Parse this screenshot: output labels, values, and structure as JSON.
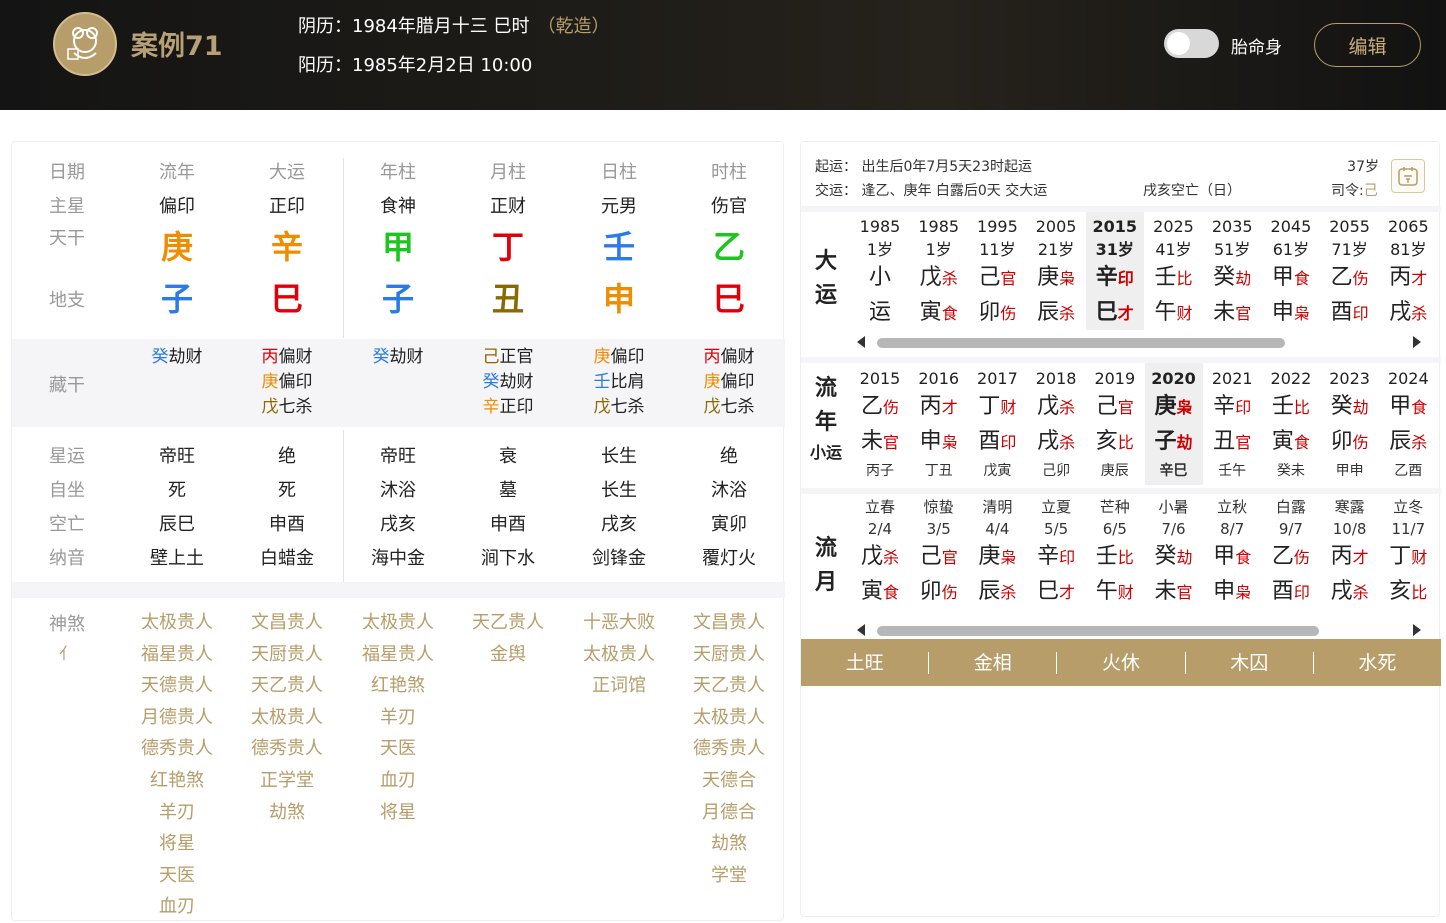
{
  "header": {
    "title": "案例71",
    "lunar_label": "阴历：1984年腊月十三 巳时",
    "lunar_gender": "（乾造）",
    "solar_label": "阳历：1985年2月2日 10:00",
    "toggle_label": "胎命身",
    "toggle_on": false,
    "edit_label": "编辑"
  },
  "colors": {
    "gold": "#b69d6a",
    "wood": "#1fc51f",
    "fire": "#e0000a",
    "earth": "#8a6a00",
    "metal": "#f08c00",
    "water": "#2a7be6"
  },
  "pillars": {
    "row_labels": [
      "日期",
      "主星",
      "天干",
      "地支",
      "藏干",
      "星运",
      "自坐",
      "空亡",
      "纳音",
      "神煞"
    ],
    "shensha_icon": "collapse-icon",
    "columns": [
      {
        "header": "流年",
        "star": "偏印",
        "stem": "庚",
        "stem_color": "#f08c00",
        "branch": "子",
        "branch_color": "#2a7be6",
        "hidden": [
          {
            "g": "癸",
            "gc": "#2a7be6",
            "t": "劫财"
          }
        ],
        "xingyun": "帝旺",
        "zizuo": "死",
        "kongwang": "辰巳",
        "nayin": "壁上土",
        "shensha": [
          "太极贵人",
          "福星贵人",
          "天德贵人",
          "月德贵人",
          "德秀贵人",
          "红艳煞",
          "羊刃",
          "将星",
          "天医",
          "血刃"
        ]
      },
      {
        "header": "大运",
        "star": "正印",
        "stem": "辛",
        "stem_color": "#f08c00",
        "branch": "巳",
        "branch_color": "#e0000a",
        "hidden": [
          {
            "g": "丙",
            "gc": "#e0000a",
            "t": "偏财"
          },
          {
            "g": "庚",
            "gc": "#f08c00",
            "t": "偏印"
          },
          {
            "g": "戊",
            "gc": "#8a6a00",
            "t": "七杀"
          }
        ],
        "xingyun": "绝",
        "zizuo": "死",
        "kongwang": "申酉",
        "nayin": "白蜡金",
        "shensha": [
          "文昌贵人",
          "天厨贵人",
          "天乙贵人",
          "太极贵人",
          "德秀贵人",
          "正学堂",
          "劫煞"
        ]
      },
      {
        "header": "年柱",
        "star": "食神",
        "stem": "甲",
        "stem_color": "#1fc51f",
        "branch": "子",
        "branch_color": "#2a7be6",
        "hidden": [
          {
            "g": "癸",
            "gc": "#2a7be6",
            "t": "劫财"
          }
        ],
        "xingyun": "帝旺",
        "zizuo": "沐浴",
        "kongwang": "戌亥",
        "nayin": "海中金",
        "shensha": [
          "太极贵人",
          "福星贵人",
          "红艳煞",
          "羊刃",
          "天医",
          "血刃",
          "将星"
        ]
      },
      {
        "header": "月柱",
        "star": "正财",
        "stem": "丁",
        "stem_color": "#e0000a",
        "branch": "丑",
        "branch_color": "#8a6a00",
        "hidden": [
          {
            "g": "己",
            "gc": "#8a6a00",
            "t": "正官"
          },
          {
            "g": "癸",
            "gc": "#2a7be6",
            "t": "劫财"
          },
          {
            "g": "辛",
            "gc": "#f08c00",
            "t": "正印"
          }
        ],
        "xingyun": "衰",
        "zizuo": "墓",
        "kongwang": "申酉",
        "nayin": "涧下水",
        "shensha": [
          "天乙贵人",
          "金舆"
        ]
      },
      {
        "header": "日柱",
        "star": "元男",
        "stem": "壬",
        "stem_color": "#2a7be6",
        "branch": "申",
        "branch_color": "#f08c00",
        "hidden": [
          {
            "g": "庚",
            "gc": "#f08c00",
            "t": "偏印"
          },
          {
            "g": "壬",
            "gc": "#2a7be6",
            "t": "比肩"
          },
          {
            "g": "戊",
            "gc": "#8a6a00",
            "t": "七杀"
          }
        ],
        "xingyun": "长生",
        "zizuo": "长生",
        "kongwang": "戌亥",
        "nayin": "剑锋金",
        "shensha": [
          "十恶大败",
          "太极贵人",
          "正词馆"
        ]
      },
      {
        "header": "时柱",
        "star": "伤官",
        "stem": "乙",
        "stem_color": "#1fc51f",
        "branch": "巳",
        "branch_color": "#e0000a",
        "hidden": [
          {
            "g": "丙",
            "gc": "#e0000a",
            "t": "偏财"
          },
          {
            "g": "庚",
            "gc": "#f08c00",
            "t": "偏印"
          },
          {
            "g": "戊",
            "gc": "#8a6a00",
            "t": "七杀"
          }
        ],
        "xingyun": "绝",
        "zizuo": "沐浴",
        "kongwang": "寅卯",
        "nayin": "覆灯火",
        "shensha": [
          "文昌贵人",
          "天厨贵人",
          "天乙贵人",
          "太极贵人",
          "德秀贵人",
          "天德合",
          "月德合",
          "劫煞",
          "学堂"
        ]
      }
    ]
  },
  "luck": {
    "qiyun": "起运： 出生后0年7月5天23时起运",
    "jiaoyun": "交运： 逢乙、庚年 白露后0天 交大运",
    "kongwang": "戌亥空亡（日）",
    "age": "37岁",
    "siling": "司令:",
    "siling_value": "己",
    "calendar_icon": "calendar-icon",
    "dayun_label": [
      "大",
      "运"
    ],
    "dayun": [
      {
        "y": "1985",
        "a": "1岁",
        "g1": "小",
        "s1": "",
        "g2": "运",
        "s2": ""
      },
      {
        "y": "1985",
        "a": "1岁",
        "g1": "戊",
        "s1": "杀",
        "g2": "寅",
        "s2": "食"
      },
      {
        "y": "1995",
        "a": "11岁",
        "g1": "己",
        "s1": "官",
        "g2": "卯",
        "s2": "伤"
      },
      {
        "y": "2005",
        "a": "21岁",
        "g1": "庚",
        "s1": "枭",
        "g2": "辰",
        "s2": "杀"
      },
      {
        "y": "2015",
        "a": "31岁",
        "g1": "辛",
        "s1": "印",
        "g2": "巳",
        "s2": "才",
        "hl": true
      },
      {
        "y": "2025",
        "a": "41岁",
        "g1": "壬",
        "s1": "比",
        "g2": "午",
        "s2": "财"
      },
      {
        "y": "2035",
        "a": "51岁",
        "g1": "癸",
        "s1": "劫",
        "g2": "未",
        "s2": "官"
      },
      {
        "y": "2045",
        "a": "61岁",
        "g1": "甲",
        "s1": "食",
        "g2": "申",
        "s2": "枭"
      },
      {
        "y": "2055",
        "a": "71岁",
        "g1": "乙",
        "s1": "伤",
        "g2": "酉",
        "s2": "印"
      },
      {
        "y": "2065",
        "a": "81岁",
        "g1": "丙",
        "s1": "才",
        "g2": "戌",
        "s2": "杀"
      }
    ],
    "liunian_label": [
      "流",
      "年"
    ],
    "xiaoyun_label": "小运",
    "liunian": [
      {
        "y": "2015",
        "g1": "乙",
        "s1": "伤",
        "g2": "未",
        "s2": "官",
        "x": "丙子"
      },
      {
        "y": "2016",
        "g1": "丙",
        "s1": "才",
        "g2": "申",
        "s2": "枭",
        "x": "丁丑"
      },
      {
        "y": "2017",
        "g1": "丁",
        "s1": "财",
        "g2": "酉",
        "s2": "印",
        "x": "戊寅"
      },
      {
        "y": "2018",
        "g1": "戊",
        "s1": "杀",
        "g2": "戌",
        "s2": "杀",
        "x": "己卯"
      },
      {
        "y": "2019",
        "g1": "己",
        "s1": "官",
        "g2": "亥",
        "s2": "比",
        "x": "庚辰"
      },
      {
        "y": "2020",
        "g1": "庚",
        "s1": "枭",
        "g2": "子",
        "s2": "劫",
        "x": "辛巳",
        "hl": true
      },
      {
        "y": "2021",
        "g1": "辛",
        "s1": "印",
        "g2": "丑",
        "s2": "官",
        "x": "壬午"
      },
      {
        "y": "2022",
        "g1": "壬",
        "s1": "比",
        "g2": "寅",
        "s2": "食",
        "x": "癸未"
      },
      {
        "y": "2023",
        "g1": "癸",
        "s1": "劫",
        "g2": "卯",
        "s2": "伤",
        "x": "甲申"
      },
      {
        "y": "2024",
        "g1": "甲",
        "s1": "食",
        "g2": "辰",
        "s2": "杀",
        "x": "乙酉"
      }
    ],
    "liuyue_label": [
      "流",
      "月"
    ],
    "liuyue": [
      {
        "t": "立春",
        "d": "2/4",
        "g1": "戊",
        "s1": "杀",
        "g2": "寅",
        "s2": "食"
      },
      {
        "t": "惊蛰",
        "d": "3/5",
        "g1": "己",
        "s1": "官",
        "g2": "卯",
        "s2": "伤"
      },
      {
        "t": "清明",
        "d": "4/4",
        "g1": "庚",
        "s1": "枭",
        "g2": "辰",
        "s2": "杀"
      },
      {
        "t": "立夏",
        "d": "5/5",
        "g1": "辛",
        "s1": "印",
        "g2": "巳",
        "s2": "才"
      },
      {
        "t": "芒种",
        "d": "6/5",
        "g1": "壬",
        "s1": "比",
        "g2": "午",
        "s2": "财"
      },
      {
        "t": "小暑",
        "d": "7/6",
        "g1": "癸",
        "s1": "劫",
        "g2": "未",
        "s2": "官"
      },
      {
        "t": "立秋",
        "d": "8/7",
        "g1": "甲",
        "s1": "食",
        "g2": "申",
        "s2": "枭"
      },
      {
        "t": "白露",
        "d": "9/7",
        "g1": "乙",
        "s1": "伤",
        "g2": "酉",
        "s2": "印"
      },
      {
        "t": "寒露",
        "d": "10/8",
        "g1": "丙",
        "s1": "才",
        "g2": "戌",
        "s2": "杀"
      },
      {
        "t": "立冬",
        "d": "11/7",
        "g1": "丁",
        "s1": "财",
        "g2": "亥",
        "s2": "比"
      }
    ],
    "wuxing": [
      "土旺",
      "金相",
      "火休",
      "木囚",
      "水死"
    ]
  }
}
